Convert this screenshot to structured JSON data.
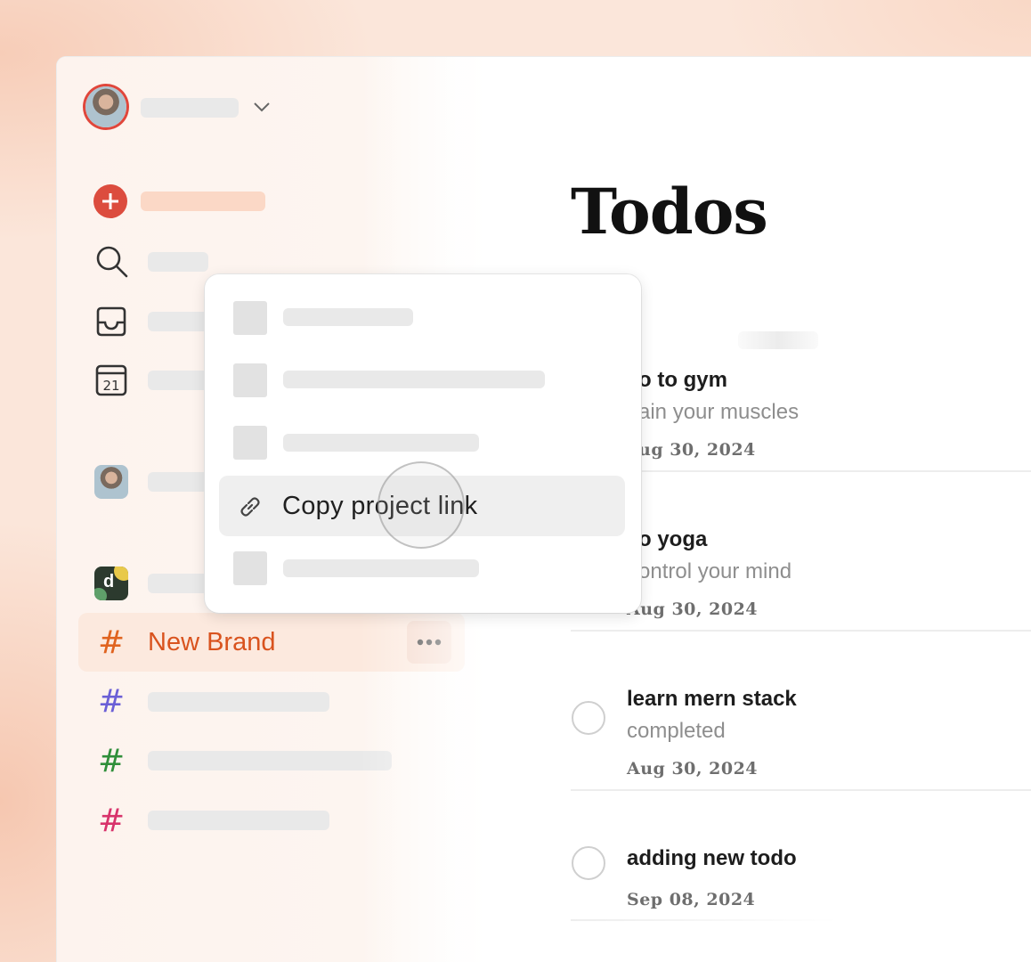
{
  "main": {
    "title": "Todos",
    "todos": [
      {
        "title": "o to gym",
        "description": "ain your muscles",
        "date": "ug 30, 2024"
      },
      {
        "title": "o yoga",
        "description": "ontrol your mind",
        "date": "Aug 30, 2024"
      },
      {
        "title": "learn mern stack",
        "description": "completed",
        "date": "Aug 30, 2024"
      },
      {
        "title": "adding new todo",
        "description": "",
        "date": "Sep 08, 2024"
      }
    ]
  },
  "sidebar": {
    "active_project": {
      "label": "New Brand",
      "hash": "#",
      "color": "#e0631f"
    },
    "projects_hash": "#",
    "project_colors": [
      "#6b5fd6",
      "#2f8f3a",
      "#d8336b"
    ],
    "workspace_badge": "d"
  },
  "context_menu": {
    "highlighted_item": "Copy project link"
  },
  "colors": {
    "accent": "#dc4c3e",
    "active_bg": "#fce9de"
  }
}
